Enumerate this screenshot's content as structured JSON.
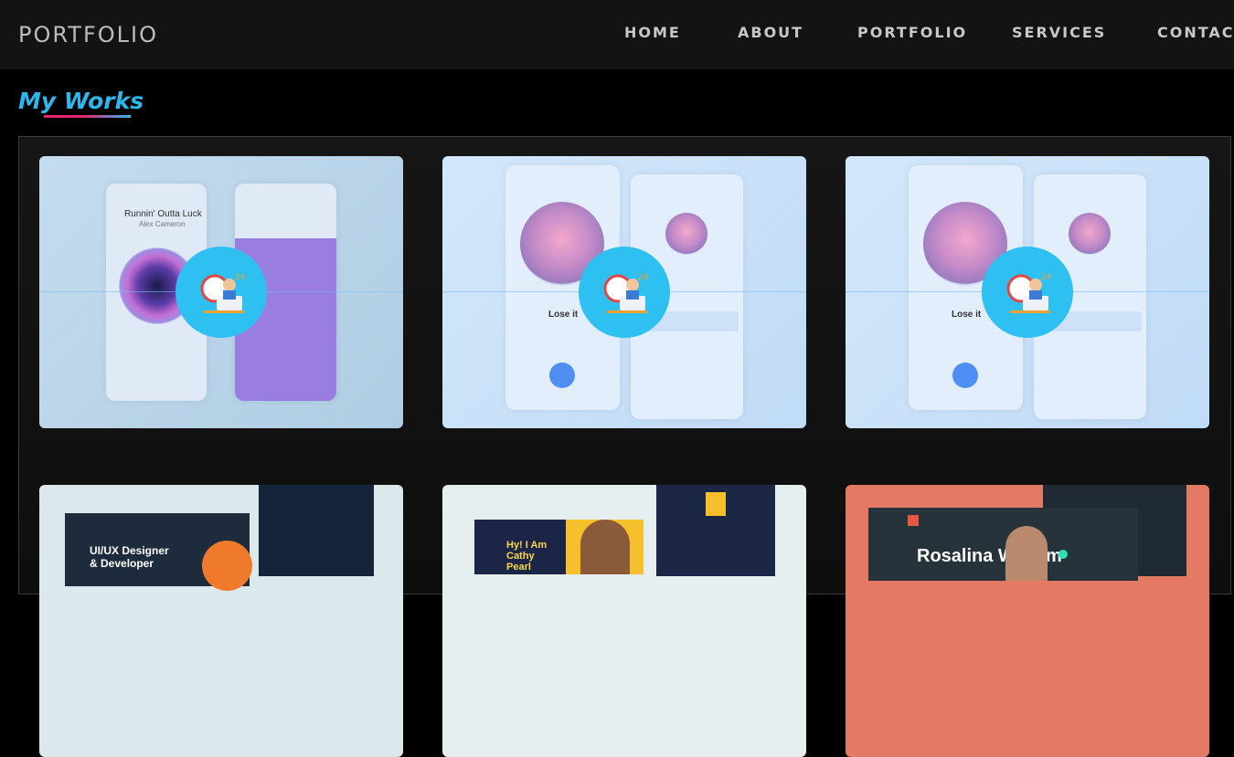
{
  "brand": "PORTFOLIO",
  "nav": [
    {
      "label": "HOME"
    },
    {
      "label": "ABOUT"
    },
    {
      "label": "PORTFOLIO"
    },
    {
      "label": "SERVICES"
    },
    {
      "label": "CONTACT"
    }
  ],
  "section_title": "My Works",
  "works": [
    {
      "track_title": "Runnin' Outta Luck",
      "track_artist": "Alex Cameron",
      "badge_icon": "developer-24h-icon",
      "theme": "music-app-purple"
    },
    {
      "track_title": "Lose it",
      "badge_icon": "developer-24h-icon",
      "theme": "music-app-blue"
    },
    {
      "track_title": "Lose it",
      "badge_icon": "developer-24h-icon",
      "theme": "music-app-blue"
    },
    {
      "headline": "UI/UX Designer\n& Developer",
      "theme": "web-dark"
    },
    {
      "headline": "Hy! I Am Cathy Pearl",
      "theme": "web-navy"
    },
    {
      "headline": "Rosalina William",
      "theme": "web-orange"
    }
  ],
  "colors": {
    "accent": "#2bb8ee",
    "accent2": "#e6246e",
    "badge": "#2ec0f1"
  }
}
